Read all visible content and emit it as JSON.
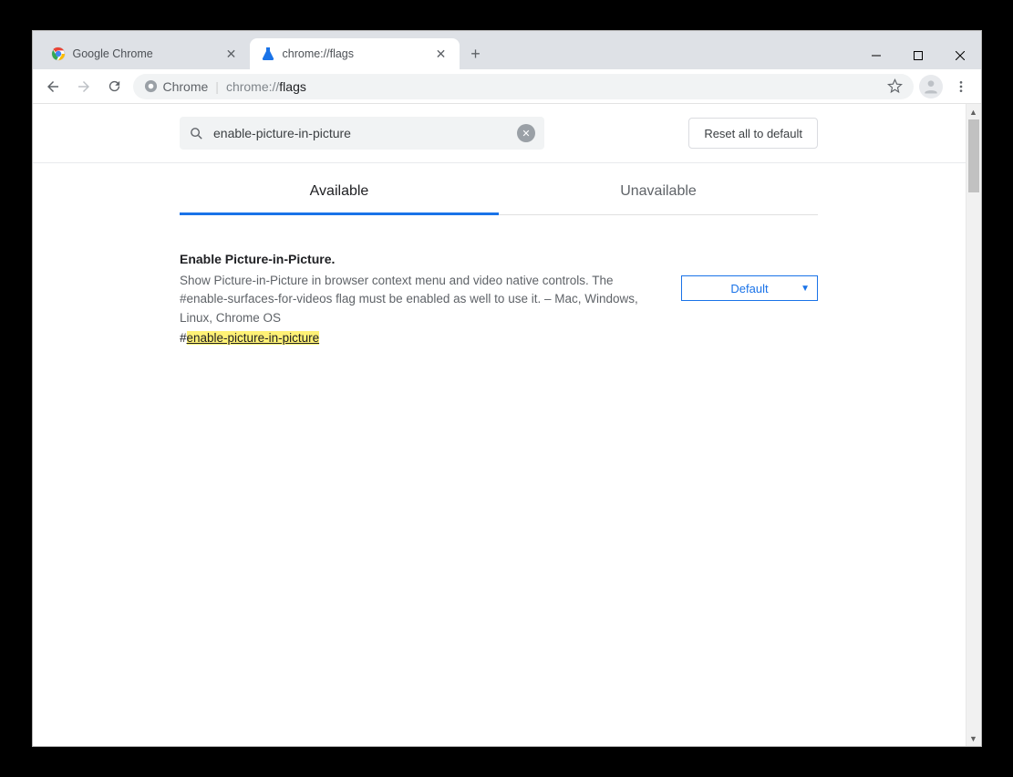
{
  "window": {
    "tabs": [
      {
        "label": "Google Chrome",
        "active": false
      },
      {
        "label": "chrome://flags",
        "active": true
      }
    ]
  },
  "toolbar": {
    "chrome_label": "Chrome",
    "url_prefix": "chrome://",
    "url_bold": "flags"
  },
  "flags_page": {
    "search_value": "enable-picture-in-picture",
    "reset_label": "Reset all to default",
    "tabs": {
      "available": "Available",
      "unavailable": "Unavailable"
    },
    "items": [
      {
        "title": "Enable Picture-in-Picture.",
        "description": "Show Picture-in-Picture in browser context menu and video native controls. The #enable-surfaces-for-videos flag must be enabled as well to use it. – Mac, Windows, Linux, Chrome OS",
        "link_hash": "#",
        "link_text": "enable-picture-in-picture",
        "select_value": "Default"
      }
    ]
  }
}
